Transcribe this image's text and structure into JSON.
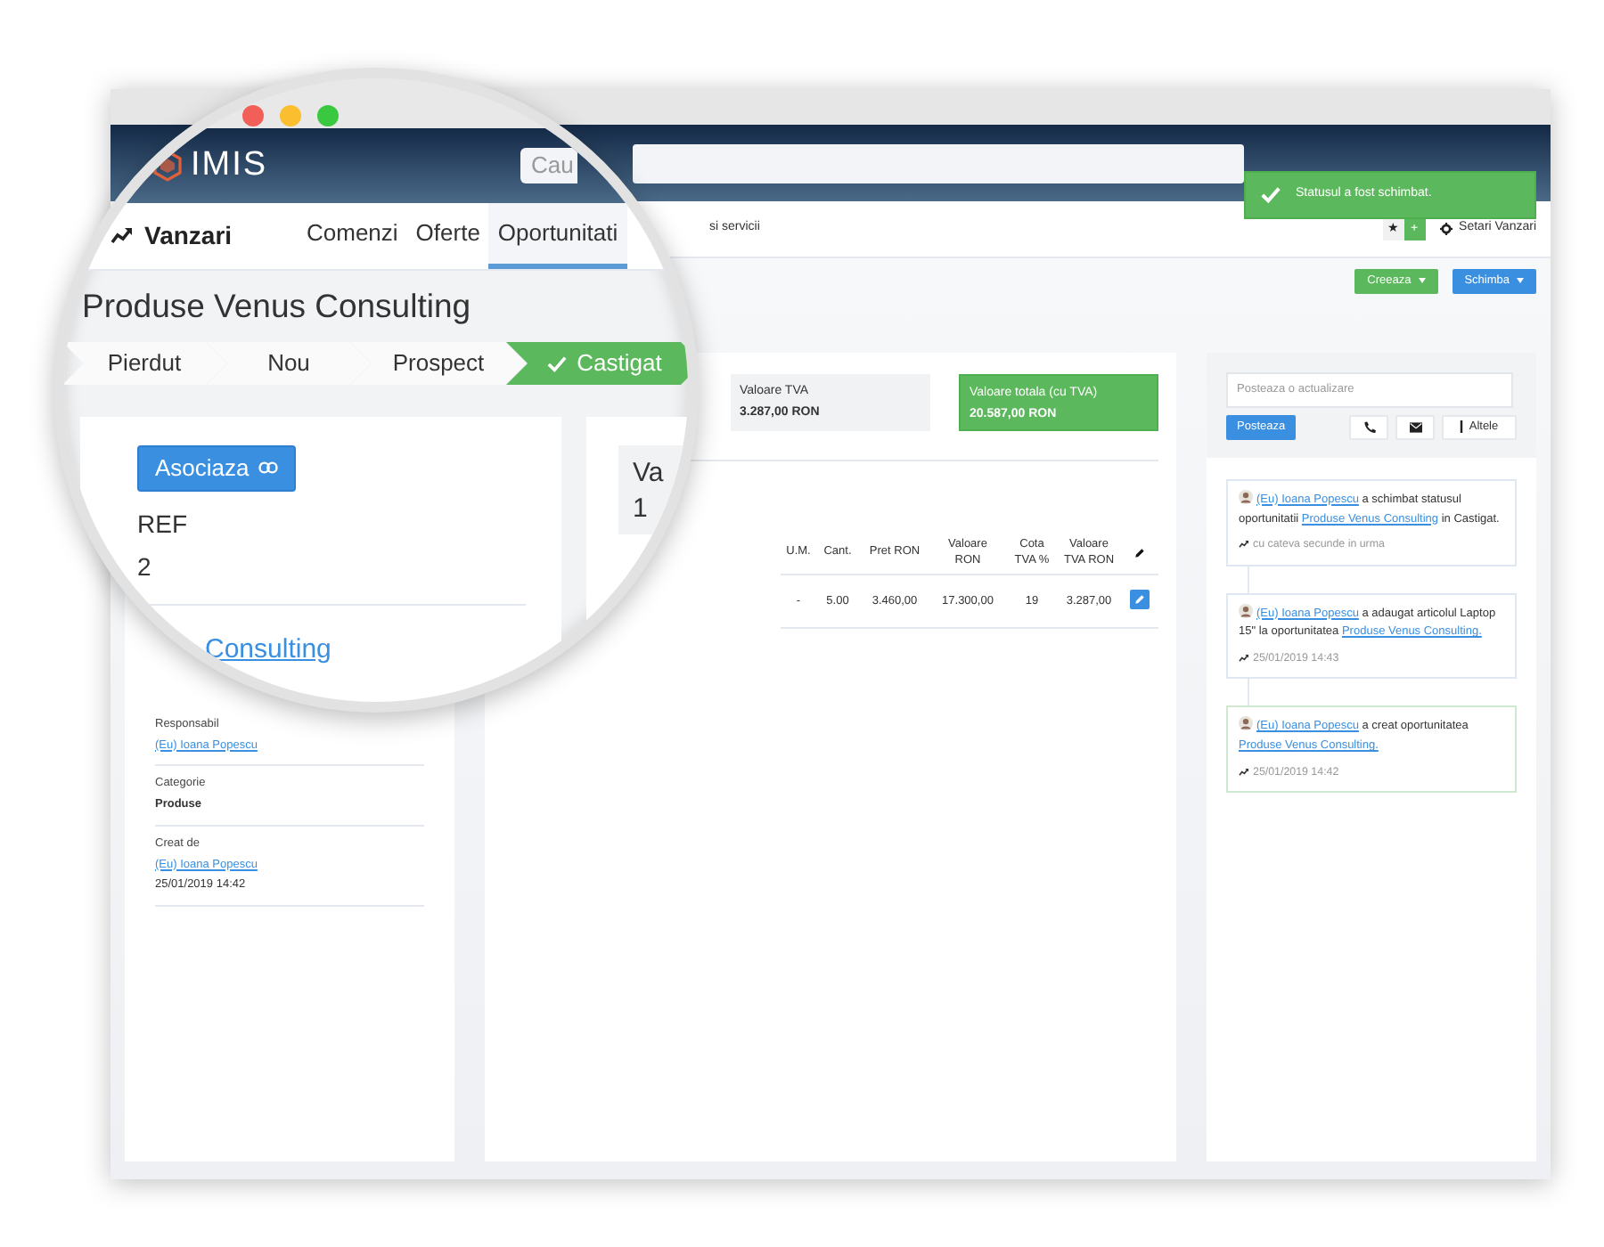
{
  "magnifier": {
    "logo_text": "IMIS",
    "search_placeholder": "Cau",
    "section": "Vanzari",
    "tabs": [
      {
        "label": "Comenzi",
        "selected": false
      },
      {
        "label": "Oferte",
        "selected": false
      },
      {
        "label": "Oportunitati",
        "selected": true
      }
    ],
    "title": "Produse Venus Consulting",
    "steps": [
      {
        "label": "Pierdut",
        "selected": false
      },
      {
        "label": "Nou",
        "selected": false
      },
      {
        "label": "Prospect",
        "selected": false
      },
      {
        "label": "Castigat",
        "selected": true
      }
    ],
    "associate_button": "Asociaza",
    "ref_label": "REF",
    "ref_value": "2",
    "client_link": "Consulting",
    "value_box_label": "Va",
    "value_box_value": "1"
  },
  "nav": {
    "partial_tab": "si servicii",
    "star": "★",
    "plus": "+",
    "settings": "Setari Vanzari"
  },
  "toast": {
    "text": "Statusul a fost schimbat."
  },
  "actions": [
    {
      "label": "Creeaza",
      "color": "#5cb85c"
    },
    {
      "label": "Schimba",
      "color": "#3a8fe0"
    }
  ],
  "details": [
    {
      "label": "Responsabil",
      "lines": [
        {
          "text": "(Eu) Ioana Popescu",
          "kind": "link"
        }
      ]
    },
    {
      "label": "Categorie",
      "lines": [
        {
          "text": "Produse",
          "kind": "strong"
        }
      ]
    },
    {
      "label": "Creat de",
      "lines": [
        {
          "text": "(Eu) Ioana Popescu",
          "kind": "link"
        },
        {
          "text": "25/01/2019 14:42",
          "kind": "plain"
        }
      ]
    }
  ],
  "totals": [
    {
      "label": "Valoare TVA",
      "value": "3.287,00 RON",
      "highlighted": false
    },
    {
      "label": "Valoare totala (cu TVA)",
      "value": "20.587,00 RON",
      "highlighted": true
    }
  ],
  "table": {
    "columns": [
      "U.M.",
      "Cant.",
      "Pret RON",
      "Valoare RON",
      "Cota TVA %",
      "Valoare TVA RON"
    ],
    "rows": [
      [
        "-",
        "5.00",
        "3.460,00",
        "17.300,00",
        "19",
        "3.287,00"
      ]
    ]
  },
  "composer": {
    "placeholder": "Posteaza o actualizare",
    "post_button": "Posteaza",
    "more_button": "Altele"
  },
  "activity": [
    {
      "color": "#dfe7f1",
      "time": "cu cateva secunde in urma",
      "segments": [
        {
          "kind": "link",
          "text": "(Eu) Ioana Popescu"
        },
        {
          "kind": "text",
          "text": " a schimbat statusul oportunitatii "
        },
        {
          "kind": "link",
          "text": "Produse Venus Consulting"
        },
        {
          "kind": "text",
          "text": " in Castigat."
        }
      ]
    },
    {
      "color": "#dfe7f1",
      "time": "25/01/2019 14:43",
      "segments": [
        {
          "kind": "link",
          "text": "(Eu) Ioana Popescu"
        },
        {
          "kind": "text",
          "text": " a adaugat articolul Laptop 15\" la oportunitatea "
        },
        {
          "kind": "link",
          "text": "Produse Venus Consulting."
        }
      ]
    },
    {
      "color": "#cfe8cf",
      "time": "25/01/2019 14:42",
      "segments": [
        {
          "kind": "link",
          "text": "(Eu) Ioana Popescu"
        },
        {
          "kind": "text",
          "text": " a creat oportunitatea "
        },
        {
          "kind": "link",
          "text": "Produse Venus Consulting."
        }
      ]
    }
  ]
}
